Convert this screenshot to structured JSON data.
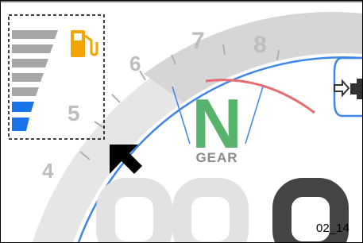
{
  "figure_id": "02_14",
  "gear": {
    "letter": "N",
    "caption": "GEAR"
  },
  "tachometer": {
    "numbers": [
      "4",
      "5",
      "6",
      "7",
      "8"
    ],
    "redline_color": "#e96a6f",
    "arc_color": "#3e86e8"
  },
  "fuel_gauge": {
    "icon": "fuel-pump-icon",
    "icon_color": "#f2a400",
    "segments_total": 7,
    "segments_lit": 2,
    "lit_color": "#1a73e8",
    "unlit_color": "#a6a6a6"
  },
  "indicators": {
    "side_stand_icon": "side-stand-icon"
  },
  "callout": {
    "pointer": "pointer-arrow-icon",
    "box_style": "dashed"
  },
  "speed_display": {
    "digits_visible": 3
  }
}
